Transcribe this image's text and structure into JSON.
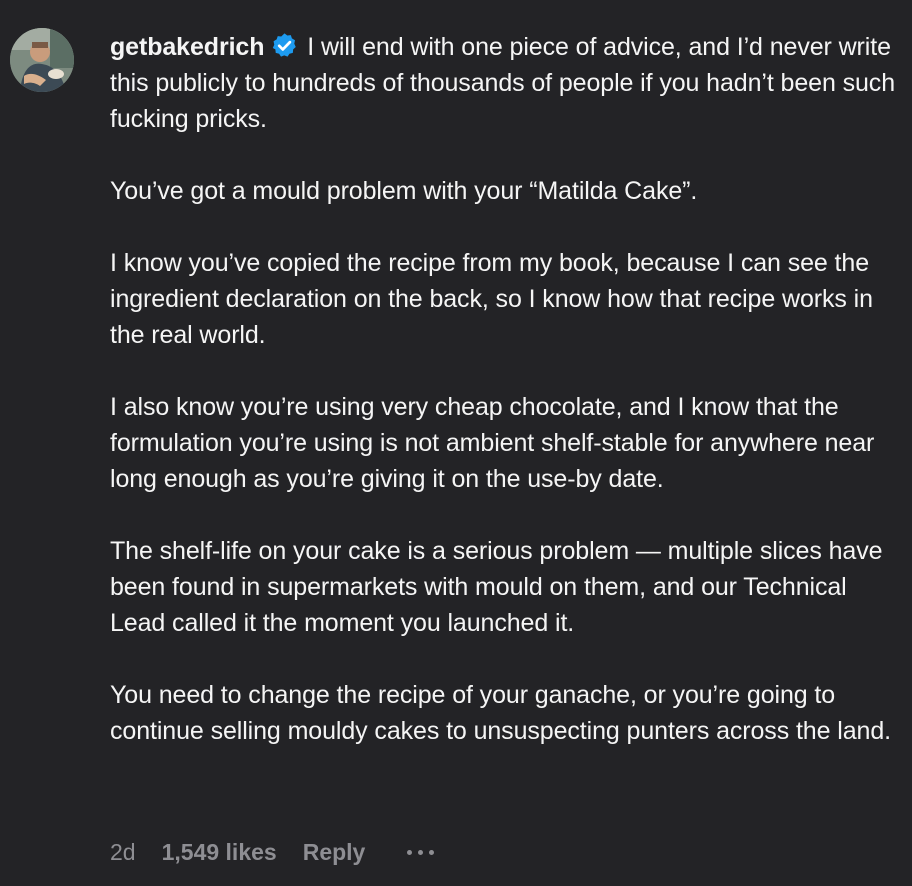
{
  "comment": {
    "username": "getbakedrich",
    "verified": true,
    "paragraphs": [
      "I will end with one piece of advice, and I’d never write this publicly to hundreds of thousands of people if you hadn’t been such fucking pricks.",
      "You’ve got a mould problem with your “Matilda Cake”.",
      "I know you’ve copied the recipe from my book, because I can see the ingredient declaration on the back, so I know how that recipe works in the real world.",
      "I also know you’re using very cheap chocolate, and I know that the formulation you’re using is not ambient shelf-stable for anywhere near long enough as you’re giving it on the use-by date.",
      "The shelf-life on your cake is a serious problem — multiple slices have been found in supermarkets with mould on them, and our Technical Lead called it the moment you launched it.",
      "You need to change the recipe of your ganache, or you’re going to continue selling mouldy cakes to unsuspecting punters across the land."
    ],
    "footer": {
      "time": "2d",
      "likes": "1,549 likes",
      "reply": "Reply"
    }
  },
  "icons": {
    "verified_badge": "verified-badge-icon",
    "more": "more-options-icon"
  },
  "colors": {
    "background": "#232326",
    "text": "#f5f5f5",
    "muted": "#8e8e93",
    "verified": "#1d9bf0"
  }
}
